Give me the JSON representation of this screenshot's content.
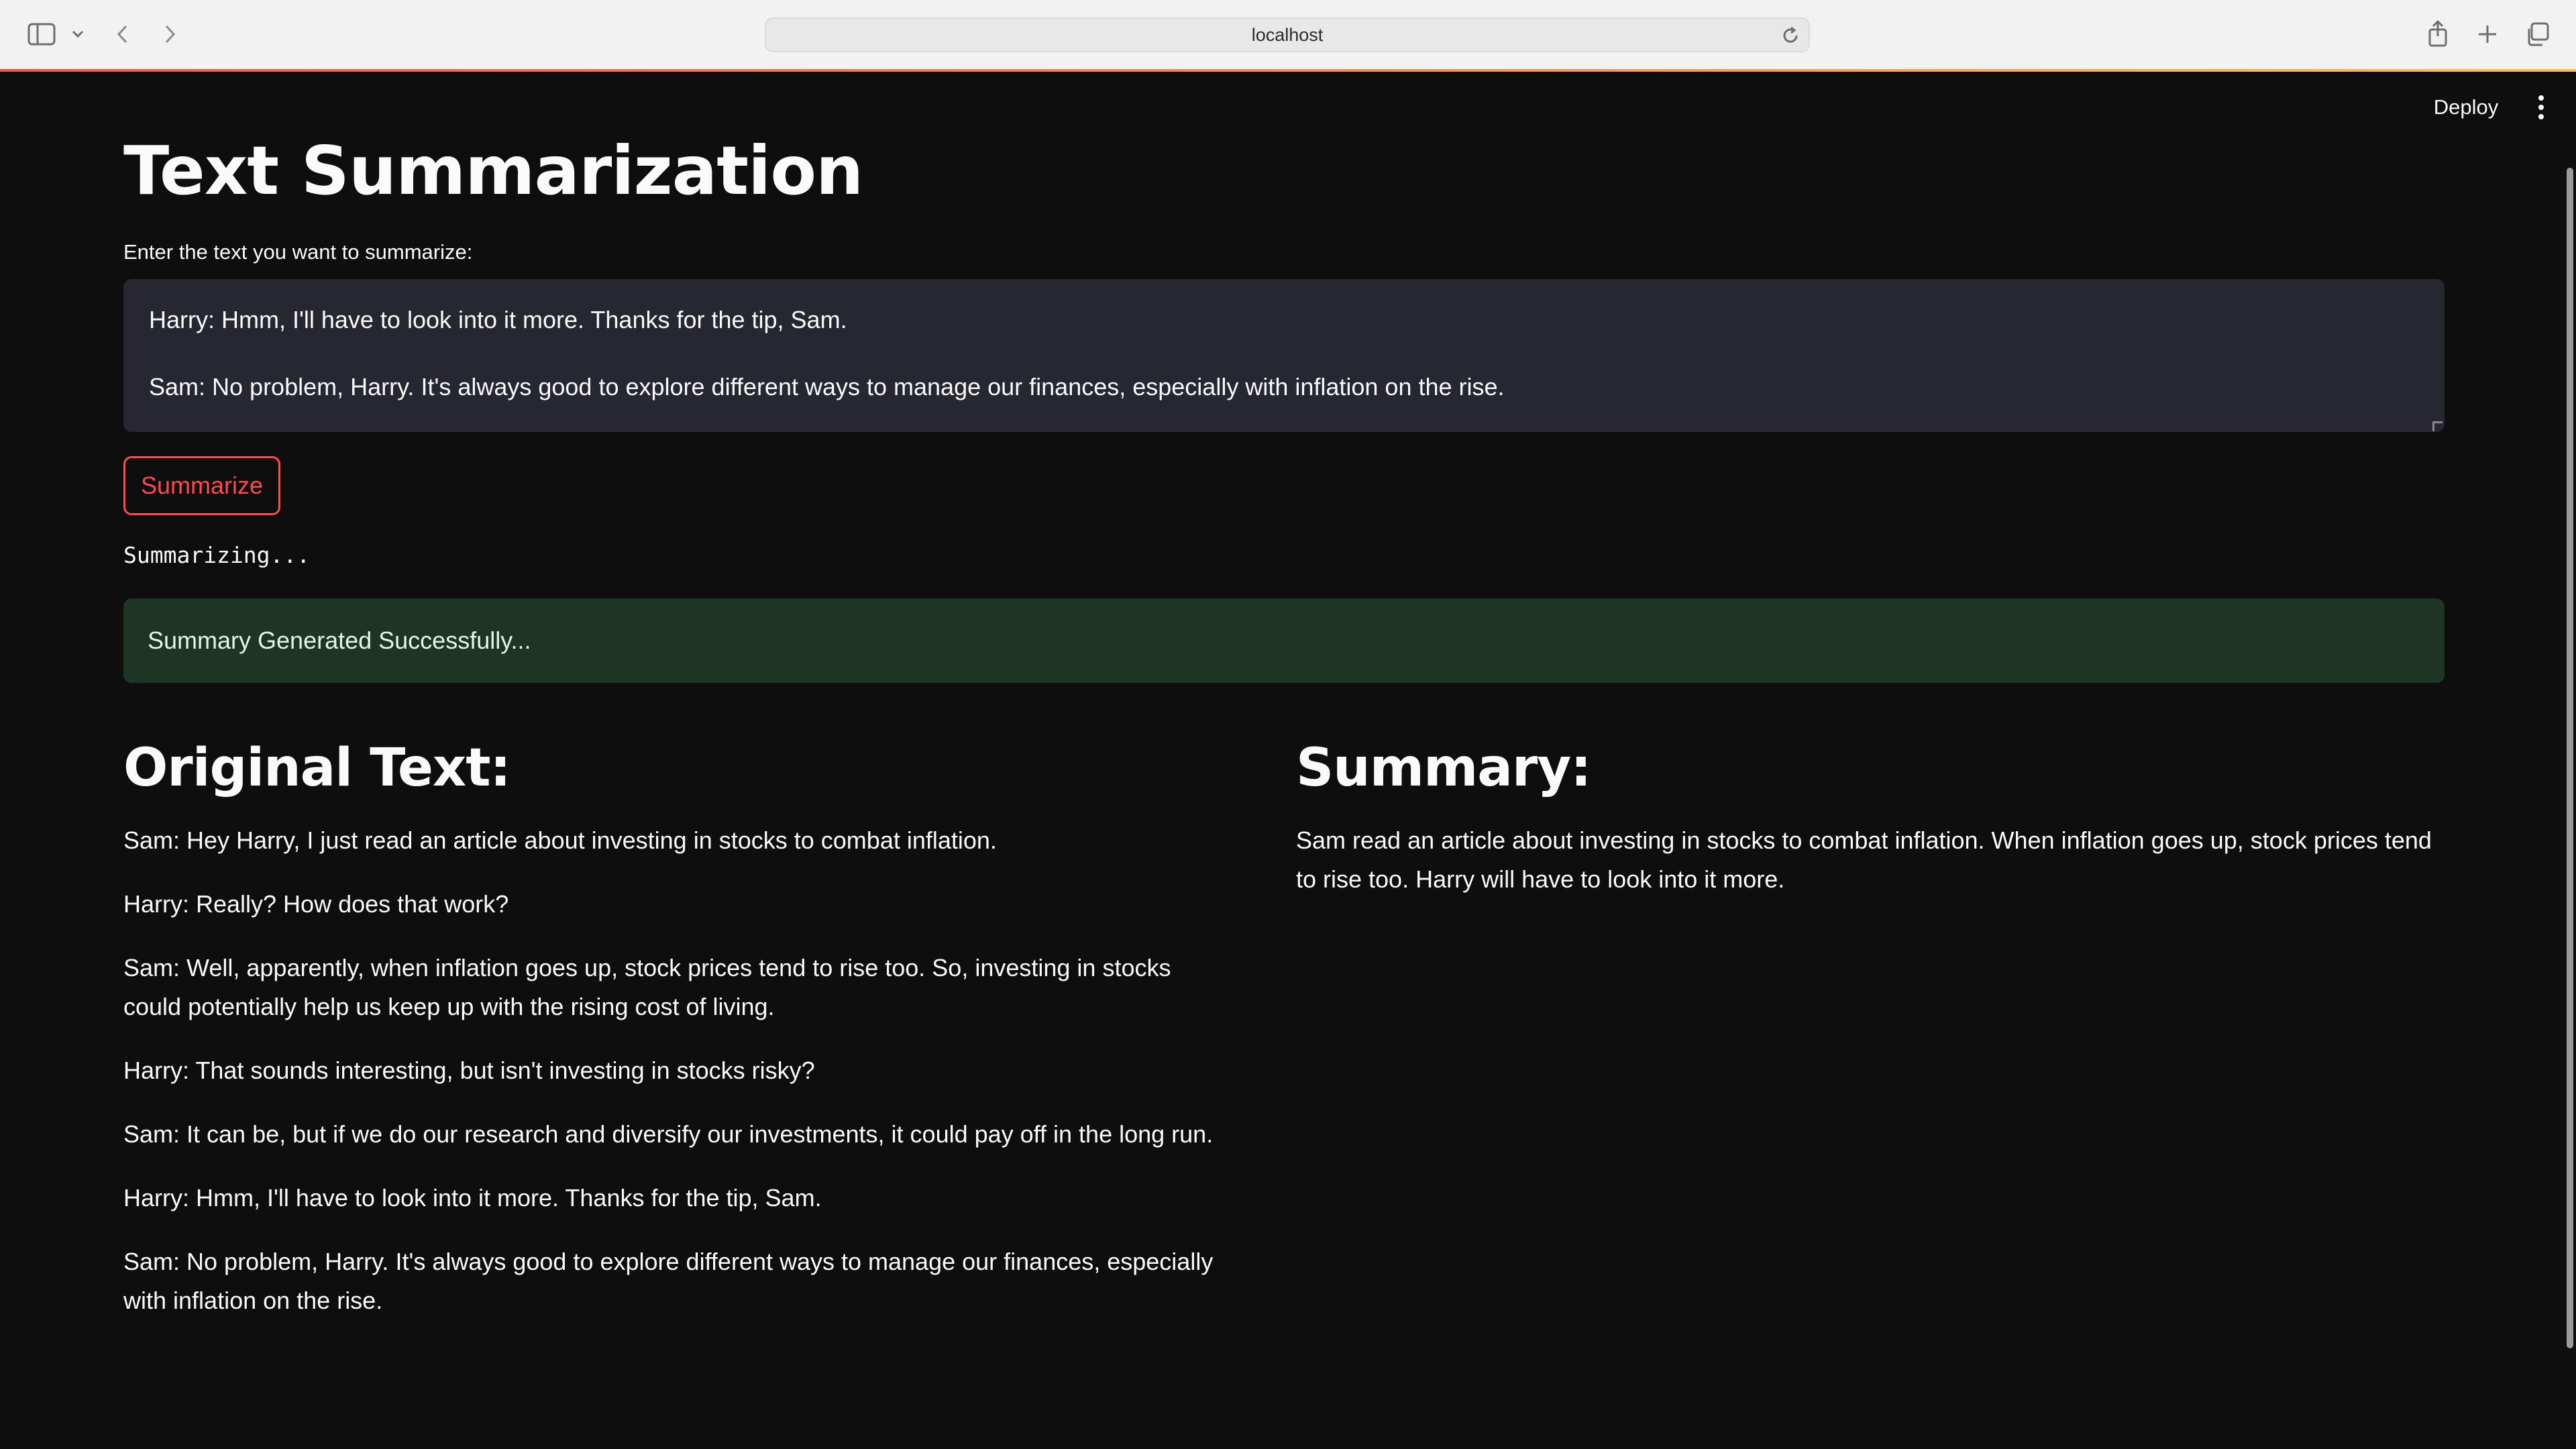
{
  "browser": {
    "address": "localhost",
    "icons": [
      "sidebar-icon",
      "chevron-down-icon",
      "back-icon",
      "forward-icon",
      "reload-icon",
      "share-icon",
      "new-tab-icon",
      "tabs-overview-icon"
    ]
  },
  "header": {
    "deploy_label": "Deploy",
    "menu_icon": "more-vertical-icon"
  },
  "main": {
    "title": "Text Summarization",
    "input_label": "Enter the text you want to summarize:",
    "textarea_lines": [
      "Harry: Hmm, I'll have to look into it more. Thanks for the tip, Sam.",
      "Sam: No problem, Harry. It's always good to explore different ways to manage our finances, especially with inflation on the rise."
    ],
    "summarize_label": "Summarize",
    "status": "Summarizing...",
    "success_message": "Summary Generated Successfully...",
    "original": {
      "heading": "Original Text:",
      "paragraphs": [
        "Sam: Hey Harry, I just read an article about investing in stocks to combat inflation.",
        "Harry: Really? How does that work?",
        "Sam: Well, apparently, when inflation goes up, stock prices tend to rise too. So, investing in stocks could potentially help us keep up with the rising cost of living.",
        "Harry: That sounds interesting, but isn't investing in stocks risky?",
        "Sam: It can be, but if we do our research and diversify our investments, it could pay off in the long run.",
        "Harry: Hmm, I'll have to look into it more. Thanks for the tip, Sam.",
        "Sam: No problem, Harry. It's always good to explore different ways to manage our finances, especially with inflation on the rise."
      ]
    },
    "summary": {
      "heading": "Summary:",
      "text": "Sam read an article about investing in stocks to combat inflation. When inflation goes up, stock prices tend to rise too. Harry will have to look into it more."
    }
  },
  "colors": {
    "background": "#0e0e0f",
    "accent": "#ff4b4b",
    "success_bg": "#1e3526",
    "textarea_bg": "#262730"
  }
}
